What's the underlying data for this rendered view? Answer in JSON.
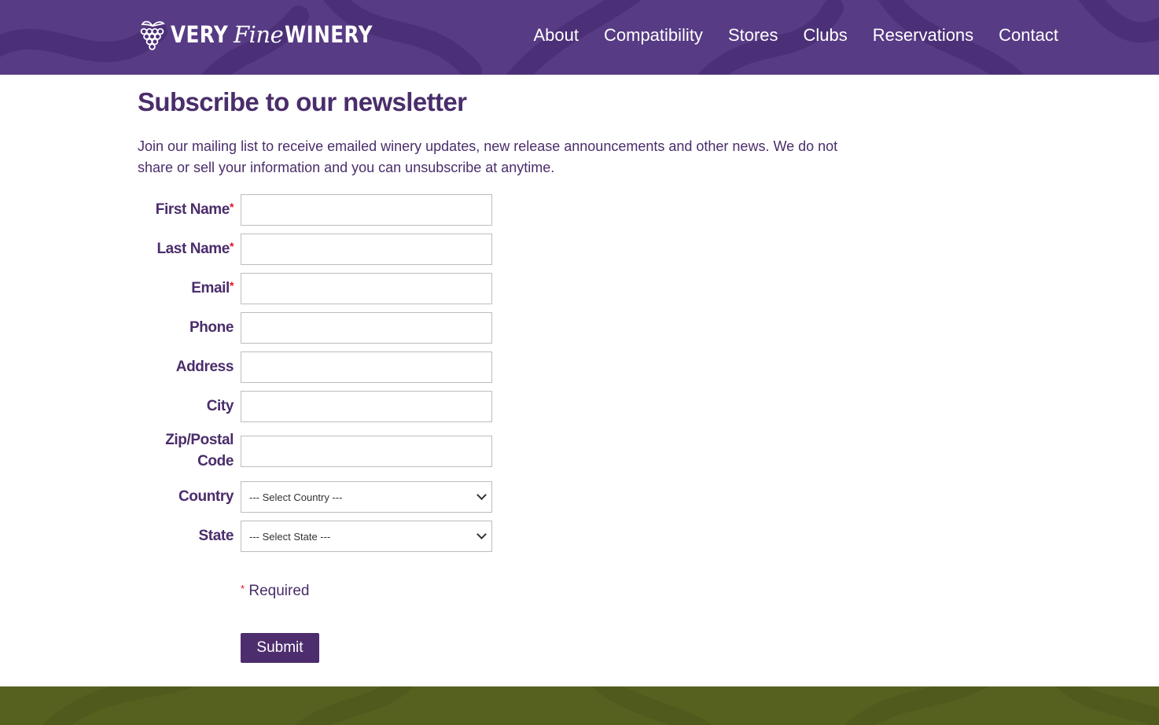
{
  "brand": {
    "very": "VERY",
    "fine": "Fine",
    "winery": "WINERY",
    "logo_icon": "grape-cluster-icon",
    "colors": {
      "header": "#573b84",
      "footer": "#56601f",
      "accent": "#4a2d6b",
      "required": "#e0102a"
    }
  },
  "nav": {
    "items": [
      {
        "label": "About"
      },
      {
        "label": "Compatibility"
      },
      {
        "label": "Stores"
      },
      {
        "label": "Clubs"
      },
      {
        "label": "Reservations"
      },
      {
        "label": "Contact"
      }
    ]
  },
  "page": {
    "title": "Subscribe to our newsletter",
    "intro": "Join our mailing list to receive emailed winery updates, new release announcements and other news. We do not share or sell your information and you can unsubscribe at anytime."
  },
  "form": {
    "first_name": {
      "label": "First Name",
      "required_mark": "*",
      "value": ""
    },
    "last_name": {
      "label": "Last Name",
      "required_mark": "*",
      "value": ""
    },
    "email": {
      "label": "Email",
      "required_mark": "*",
      "value": ""
    },
    "phone": {
      "label": "Phone",
      "value": ""
    },
    "address": {
      "label": "Address",
      "value": ""
    },
    "city": {
      "label": "City",
      "value": ""
    },
    "zip": {
      "label_line1": "Zip/Postal",
      "label_line2": "Code",
      "value": ""
    },
    "country": {
      "label": "Country",
      "selected": "--- Select Country ---"
    },
    "state": {
      "label": "State",
      "selected": "--- Select State ---"
    },
    "required_note": {
      "mark": "*",
      "text": "Required"
    },
    "submit_label": "Submit"
  }
}
